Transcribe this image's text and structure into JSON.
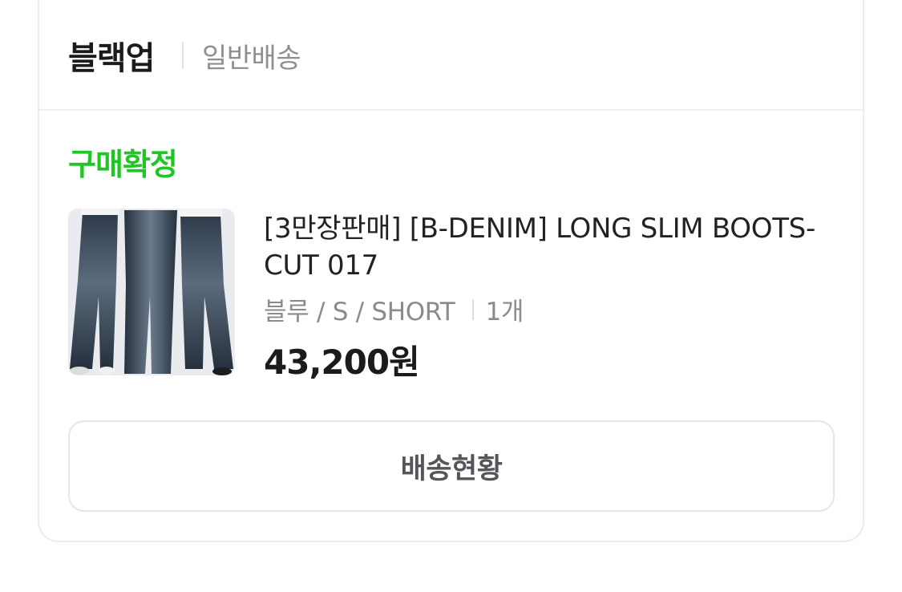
{
  "header": {
    "store_name": "블랙업",
    "shipping_type": "일반배송"
  },
  "order": {
    "status": "구매확정",
    "status_color": "#1ec723"
  },
  "product": {
    "name": "[3만장판매] [B-DENIM] LONG SLIM BOOTS-CUT 017",
    "option": "블루 / S / SHORT",
    "quantity": "1개",
    "price": "43,200원",
    "image_icon": "jeans-product-thumbnail"
  },
  "actions": {
    "track_shipping_label": "배송현황"
  }
}
